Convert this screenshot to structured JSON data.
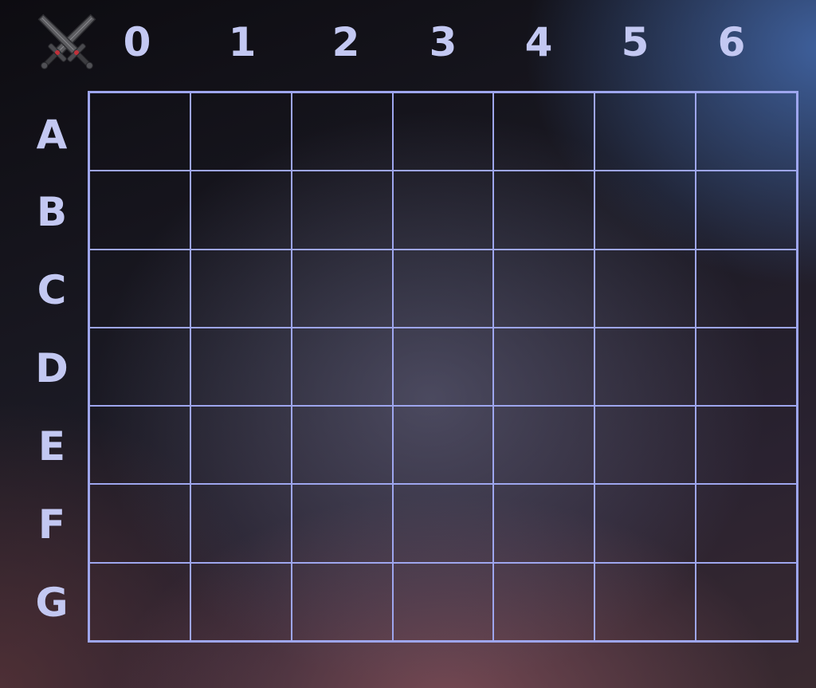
{
  "columns": [
    "0",
    "1",
    "2",
    "3",
    "4",
    "5",
    "6"
  ],
  "rows": [
    "A",
    "B",
    "C",
    "D",
    "E",
    "F",
    "G"
  ],
  "logo_icon": "crossed-swords-icon",
  "colors": {
    "grid_line": "#9ea6ee",
    "label": "#c3c8f2",
    "background_dark": "#141319"
  }
}
